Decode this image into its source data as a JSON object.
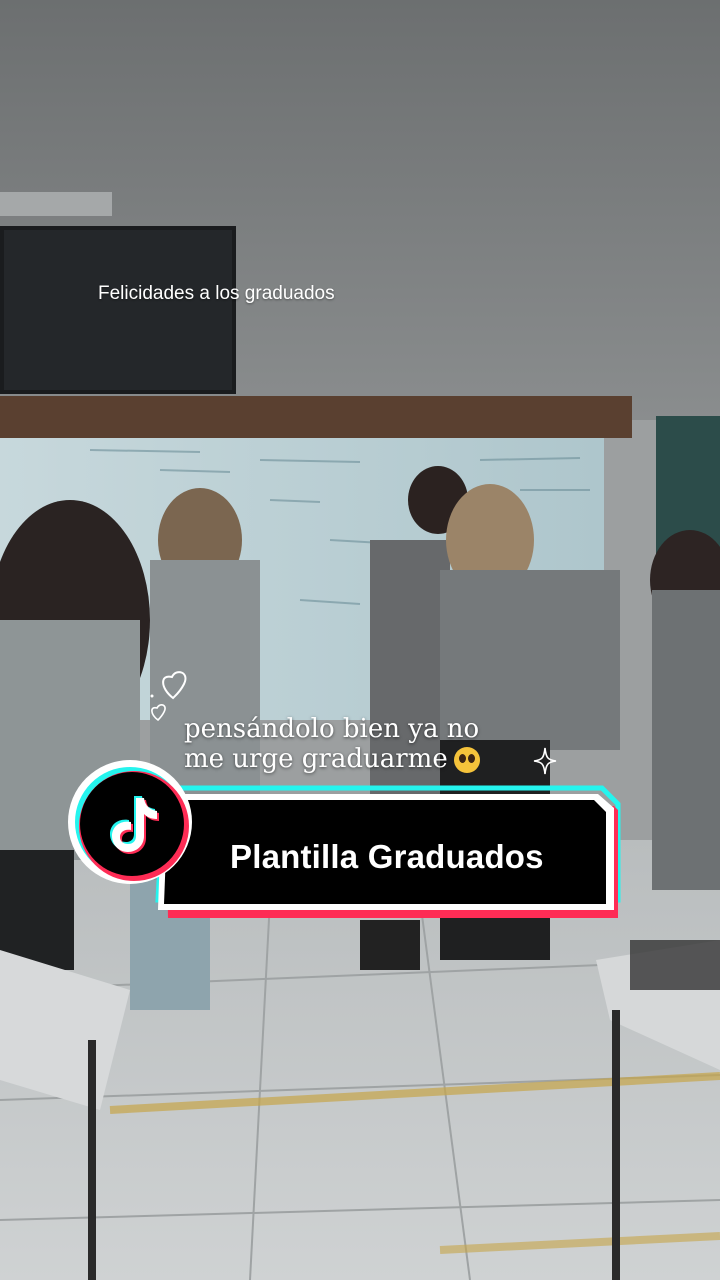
{
  "video": {
    "caption_top": "Felicidades a los graduados",
    "overlay_line1": "pensándolo bien ya no",
    "overlay_line2": "me urge graduarme"
  },
  "badge": {
    "label": "Plantilla Graduados",
    "logo": "tiktok-logo-icon"
  },
  "colors": {
    "cyan": "#25f4ee",
    "pink": "#fe2c55"
  }
}
